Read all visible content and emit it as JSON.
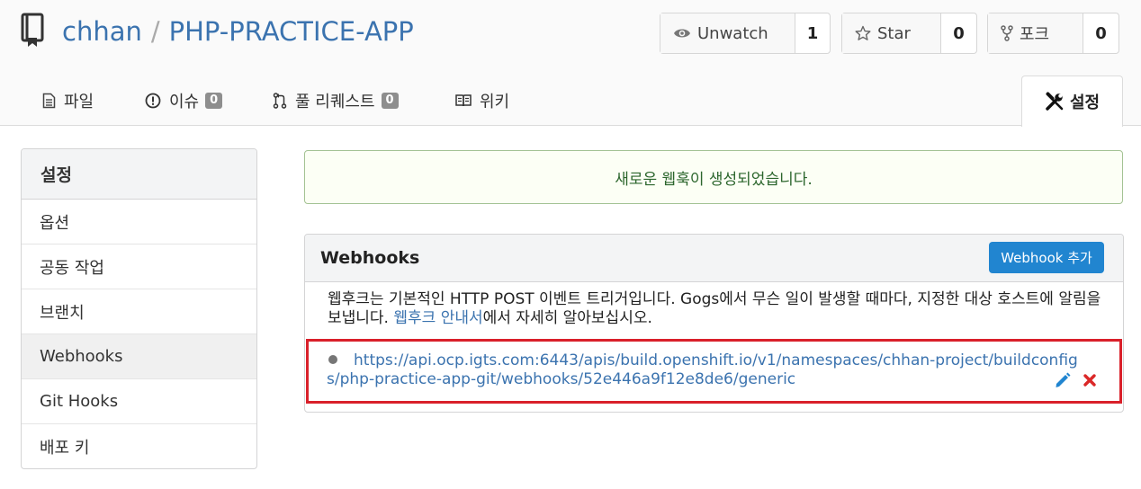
{
  "repo": {
    "owner": "chhan",
    "separator": "/",
    "name": "PHP-PRACTICE-APP"
  },
  "actions": {
    "watch_label": "Unwatch",
    "watch_count": "1",
    "star_label": "Star",
    "star_count": "0",
    "fork_label": "포크",
    "fork_count": "0"
  },
  "tabs": {
    "files": "파일",
    "issues": "이슈",
    "issues_count": "0",
    "pulls": "풀 리퀘스트",
    "pulls_count": "0",
    "wiki": "위키",
    "settings": "설정"
  },
  "sidebar": {
    "header": "설정",
    "items": [
      {
        "label": "옵션"
      },
      {
        "label": "공동 작업"
      },
      {
        "label": "브랜치"
      },
      {
        "label": "Webhooks"
      },
      {
        "label": "Git Hooks"
      },
      {
        "label": "배포 키"
      }
    ]
  },
  "flash": {
    "message": "새로운 웹훅이 생성되었습니다."
  },
  "webhooks": {
    "title": "Webhooks",
    "add_button": "Webhook 추가",
    "description_before": "웹후크는 기본적인 HTTP POST 이벤트 트리거입니다. Gogs에서 무슨 일이 발생할 때마다, 지정한 대상 호스트에 알림을 보냅니다. ",
    "description_link": "웹후크 안내서",
    "description_after": "에서 자세히 알아보십시오.",
    "hook_url": "https://api.ocp.igts.com:6443/apis/build.openshift.io/v1/namespaces/chhan-project/buildconfigs/php-practice-app-git/webhooks/52e446a9f12e8de6/generic"
  },
  "icons": {
    "repo": "repo-icon",
    "watch": "eye-icon",
    "star": "star-icon",
    "fork": "fork-icon",
    "files": "file-text-icon",
    "issues": "issue-opened-icon",
    "pulls": "pull-request-icon",
    "wiki": "book-icon",
    "settings": "tools-icon",
    "hook_status": "dot-icon",
    "edit": "pencil-icon",
    "delete": "close-icon"
  },
  "colors": {
    "link": "#3b73af",
    "primary": "#2185d0",
    "success_text": "#2c662d",
    "success_bg": "#fcfff5",
    "delete": "#db2828",
    "highlight_box": "#d9202a"
  }
}
